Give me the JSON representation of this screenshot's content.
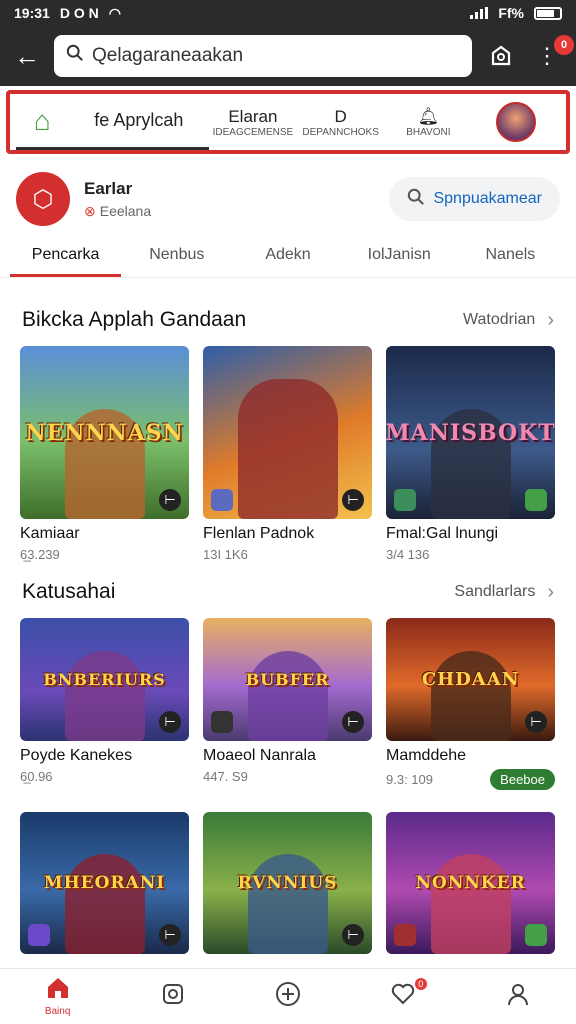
{
  "status": {
    "time": "19:31",
    "left_icons": "D O N",
    "right_text": "Ff%"
  },
  "topbar": {
    "search_text": "Qelagaraneaakan",
    "notification_badge": "0"
  },
  "app_tabs": [
    {
      "main": "fe Aprylcah",
      "sub": ""
    },
    {
      "main": "Elaran",
      "sub": "IDEAGCEMENSE"
    },
    {
      "main": "D",
      "sub": "DEPANNCHOKS"
    },
    {
      "main": "",
      "sub": "BHAVONI"
    }
  ],
  "profile": {
    "name": "Earlar",
    "subtitle": "Eeelana",
    "button_label": "Spnpuakamear"
  },
  "category_tabs": [
    "Pencarka",
    "Nenbus",
    "Adekn",
    "IolJanisn",
    "Nanels"
  ],
  "sections": [
    {
      "title": "Bikcka Applah Gandaan",
      "more": "Watodrian",
      "cards": [
        {
          "image_title": "NENNNASN",
          "name": "Kamiaar",
          "meta": "6̲3.239",
          "badge": ""
        },
        {
          "image_title": "",
          "name": "Flenlan Padnok",
          "meta": "13I 1K6",
          "badge": ""
        },
        {
          "image_title": "MANISBOKT",
          "name": "Fmal:Gal lnungi",
          "meta": "3/4 136",
          "badge": ""
        }
      ]
    },
    {
      "title": "Katusahai",
      "more": "Sandlarlars",
      "cards": [
        {
          "image_title": "BNBERIURS",
          "name": "Poyde Kanekes",
          "meta": "⁠6̲0.96",
          "badge": ""
        },
        {
          "image_title": "BUBFER",
          "name": "Moaeol Nanrala",
          "meta": "447. S9",
          "badge": ""
        },
        {
          "image_title": "CHDAAN",
          "name": "Mamddehe",
          "meta": "9.3: 109",
          "badge": "Beeboe"
        }
      ]
    },
    {
      "title": "",
      "more": "",
      "cards": [
        {
          "image_title": "MHEORANI",
          "name": "",
          "meta": "",
          "badge": ""
        },
        {
          "image_title": "RVNNIUS",
          "name": "",
          "meta": "",
          "badge": ""
        },
        {
          "image_title": "NONNKER",
          "name": "",
          "meta": "",
          "badge": ""
        }
      ]
    }
  ],
  "bottom_nav": {
    "home_label": "Bainq",
    "notification_badge": "0"
  },
  "colors": {
    "accent": "#d32f2f",
    "dark_bar": "#2b2b2b",
    "link_blue": "#1565c0"
  }
}
